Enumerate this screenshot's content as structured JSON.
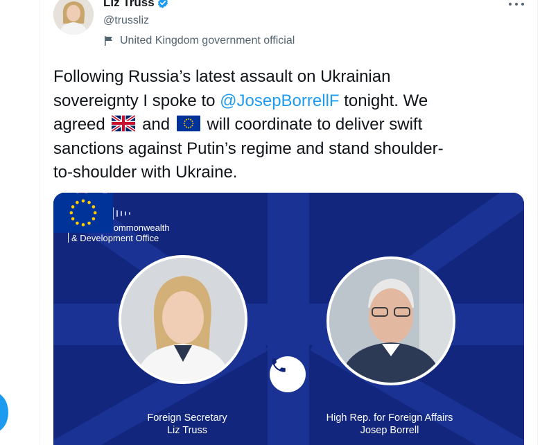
{
  "author": {
    "name": "Liz Truss",
    "handle": "@trussliz",
    "label": "United Kingdom government official",
    "verified_icon": "verified-badge-icon",
    "label_icon": "flag-icon"
  },
  "tweet": {
    "line1": "Following Russia’s latest assault on Ukrainian",
    "line2_before": "sovereignty I spoke to ",
    "mention": "@JosepBorrellF",
    "line2_after": " tonight. We",
    "line3_before": "agreed ",
    "line3_mid": " and ",
    "line3_after": " will coordinate to deliver swift",
    "line4": "sanctions against Putin’s regime and stand shoulder-",
    "line5": "to-shoulder with Ukraine.",
    "emoji_1": "uk-flag-emoji",
    "emoji_2": "eu-flag-emoji"
  },
  "media": {
    "org_line1": "Foreign, Commonwealth",
    "org_line2": "& Development Office",
    "left_caption_1": "Foreign Secretary",
    "left_caption_2": "Liz Truss",
    "right_caption_1": "High Rep. for Foreign Affairs",
    "right_caption_2": "Josep Borrell",
    "background_color": "#10257a"
  },
  "colors": {
    "accent": "#1d9bf0",
    "text": "#0f1419",
    "secondary": "#536471"
  }
}
